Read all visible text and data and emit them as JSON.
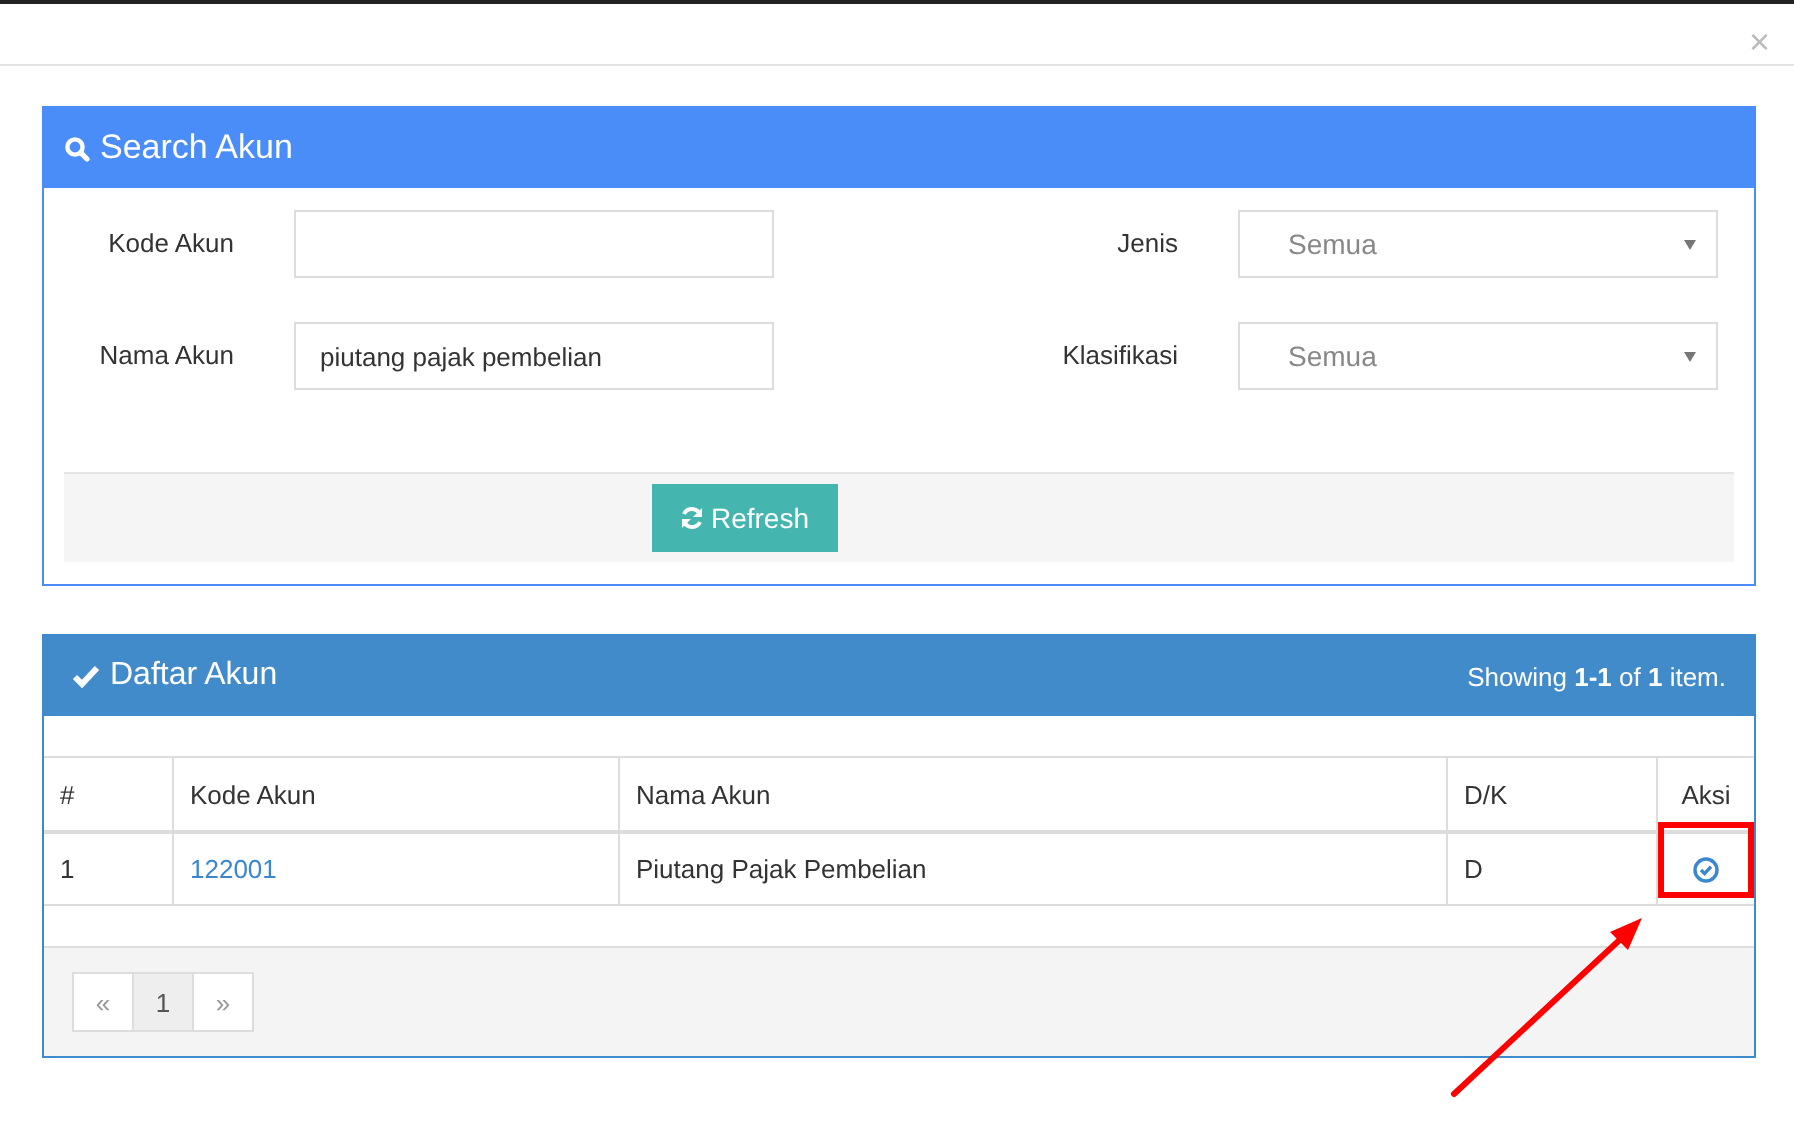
{
  "dialog": {
    "close": "×"
  },
  "search_panel": {
    "title": "Search Akun",
    "fields": [
      {
        "label": "Kode Akun",
        "kind": "text"
      },
      {
        "label": "Jenis",
        "kind": "select",
        "value": "Semua"
      },
      {
        "label": "Nama Akun",
        "kind": "text",
        "value": "piutang pajak pembelian"
      },
      {
        "label": "Klasifikasi",
        "kind": "select",
        "value": "Semua"
      }
    ],
    "refresh_button": "Refresh"
  },
  "list_panel": {
    "title": "Daftar Akun",
    "summary": "Showing **1-1** of **1** item.",
    "table": {
      "columns": [
        "#",
        "Kode Akun",
        "Nama Akun",
        "D/K",
        "Aksi"
      ],
      "rows": [
        {
          "number": "1",
          "kode": "122001",
          "nama": "Piutang Pajak Pembelian",
          "dk": "D"
        }
      ]
    },
    "pagination": [
      {
        "label": "«",
        "selected": false
      },
      {
        "label": "1",
        "selected": true
      },
      {
        "label": "»",
        "selected": false
      }
    ]
  }
}
